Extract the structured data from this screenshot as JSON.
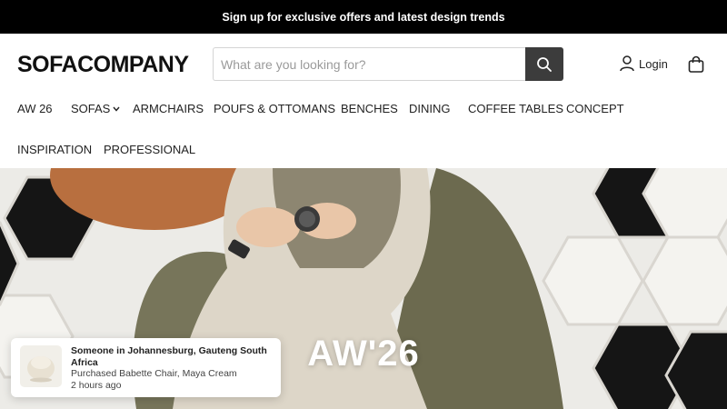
{
  "promo": {
    "text": "Sign up for exclusive offers and latest design trends"
  },
  "header": {
    "logo": "SOFACOMPANY",
    "search_placeholder": "What are you looking for?",
    "login_label": "Login"
  },
  "nav": {
    "items": [
      "AW 26",
      "SOFAS",
      "ARMCHAIRS",
      "POUFS & OTTOMANS",
      "BENCHES",
      "DINING",
      "COFFEE TABLES",
      "CONCEPT",
      "INSPIRATION",
      "PROFESSIONAL"
    ]
  },
  "hero": {
    "title": "AW'26"
  },
  "toast": {
    "title": "Someone in Johannesburg, Gauteng South Africa",
    "product": "Purchased Babette Chair, Maya Cream",
    "time": "2 hours ago"
  },
  "icons": {
    "search": "search-icon",
    "user": "user-icon",
    "cart": "shopping-bag-icon",
    "chevron": "chevron-down-icon"
  },
  "colors": {
    "promo_bg": "#000000",
    "search_button": "#3c3c3c"
  }
}
